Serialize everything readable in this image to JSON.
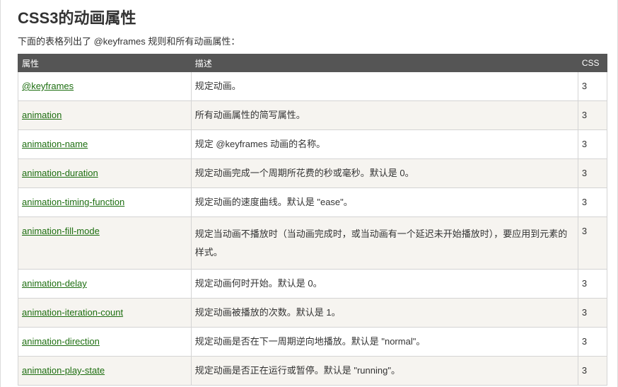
{
  "title": "CSS3的动画属性",
  "intro": "下面的表格列出了 @keyframes 规则和所有动画属性：",
  "table": {
    "headers": [
      "属性",
      "描述",
      "CSS"
    ],
    "rows": [
      {
        "property": "@keyframes",
        "description": "规定动画。",
        "css": "3"
      },
      {
        "property": "animation",
        "description": "所有动画属性的简写属性。",
        "css": "3"
      },
      {
        "property": "animation-name",
        "description": "规定 @keyframes 动画的名称。",
        "css": "3"
      },
      {
        "property": "animation-duration",
        "description": "规定动画完成一个周期所花费的秒或毫秒。默认是 0。",
        "css": "3"
      },
      {
        "property": "animation-timing-function",
        "description": "规定动画的速度曲线。默认是 \"ease\"。",
        "css": "3"
      },
      {
        "property": "animation-fill-mode",
        "description": "规定当动画不播放时（当动画完成时，或当动画有一个延迟未开始播放时），要应用到元素的样式。",
        "css": "3"
      },
      {
        "property": "animation-delay",
        "description": "规定动画何时开始。默认是 0。",
        "css": "3"
      },
      {
        "property": "animation-iteration-count",
        "description": "规定动画被播放的次数。默认是 1。",
        "css": "3"
      },
      {
        "property": "animation-direction",
        "description": "规定动画是否在下一周期逆向地播放。默认是 \"normal\"。",
        "css": "3"
      },
      {
        "property": "animation-play-state",
        "description": "规定动画是否正在运行或暂停。默认是 \"running\"。",
        "css": "3"
      }
    ]
  },
  "colors": {
    "header_bg": "#555555",
    "header_text": "#ffffff",
    "row_alt_bg": "#f6f4f0",
    "link": "#1d6e10",
    "border": "#d4d4d4"
  }
}
